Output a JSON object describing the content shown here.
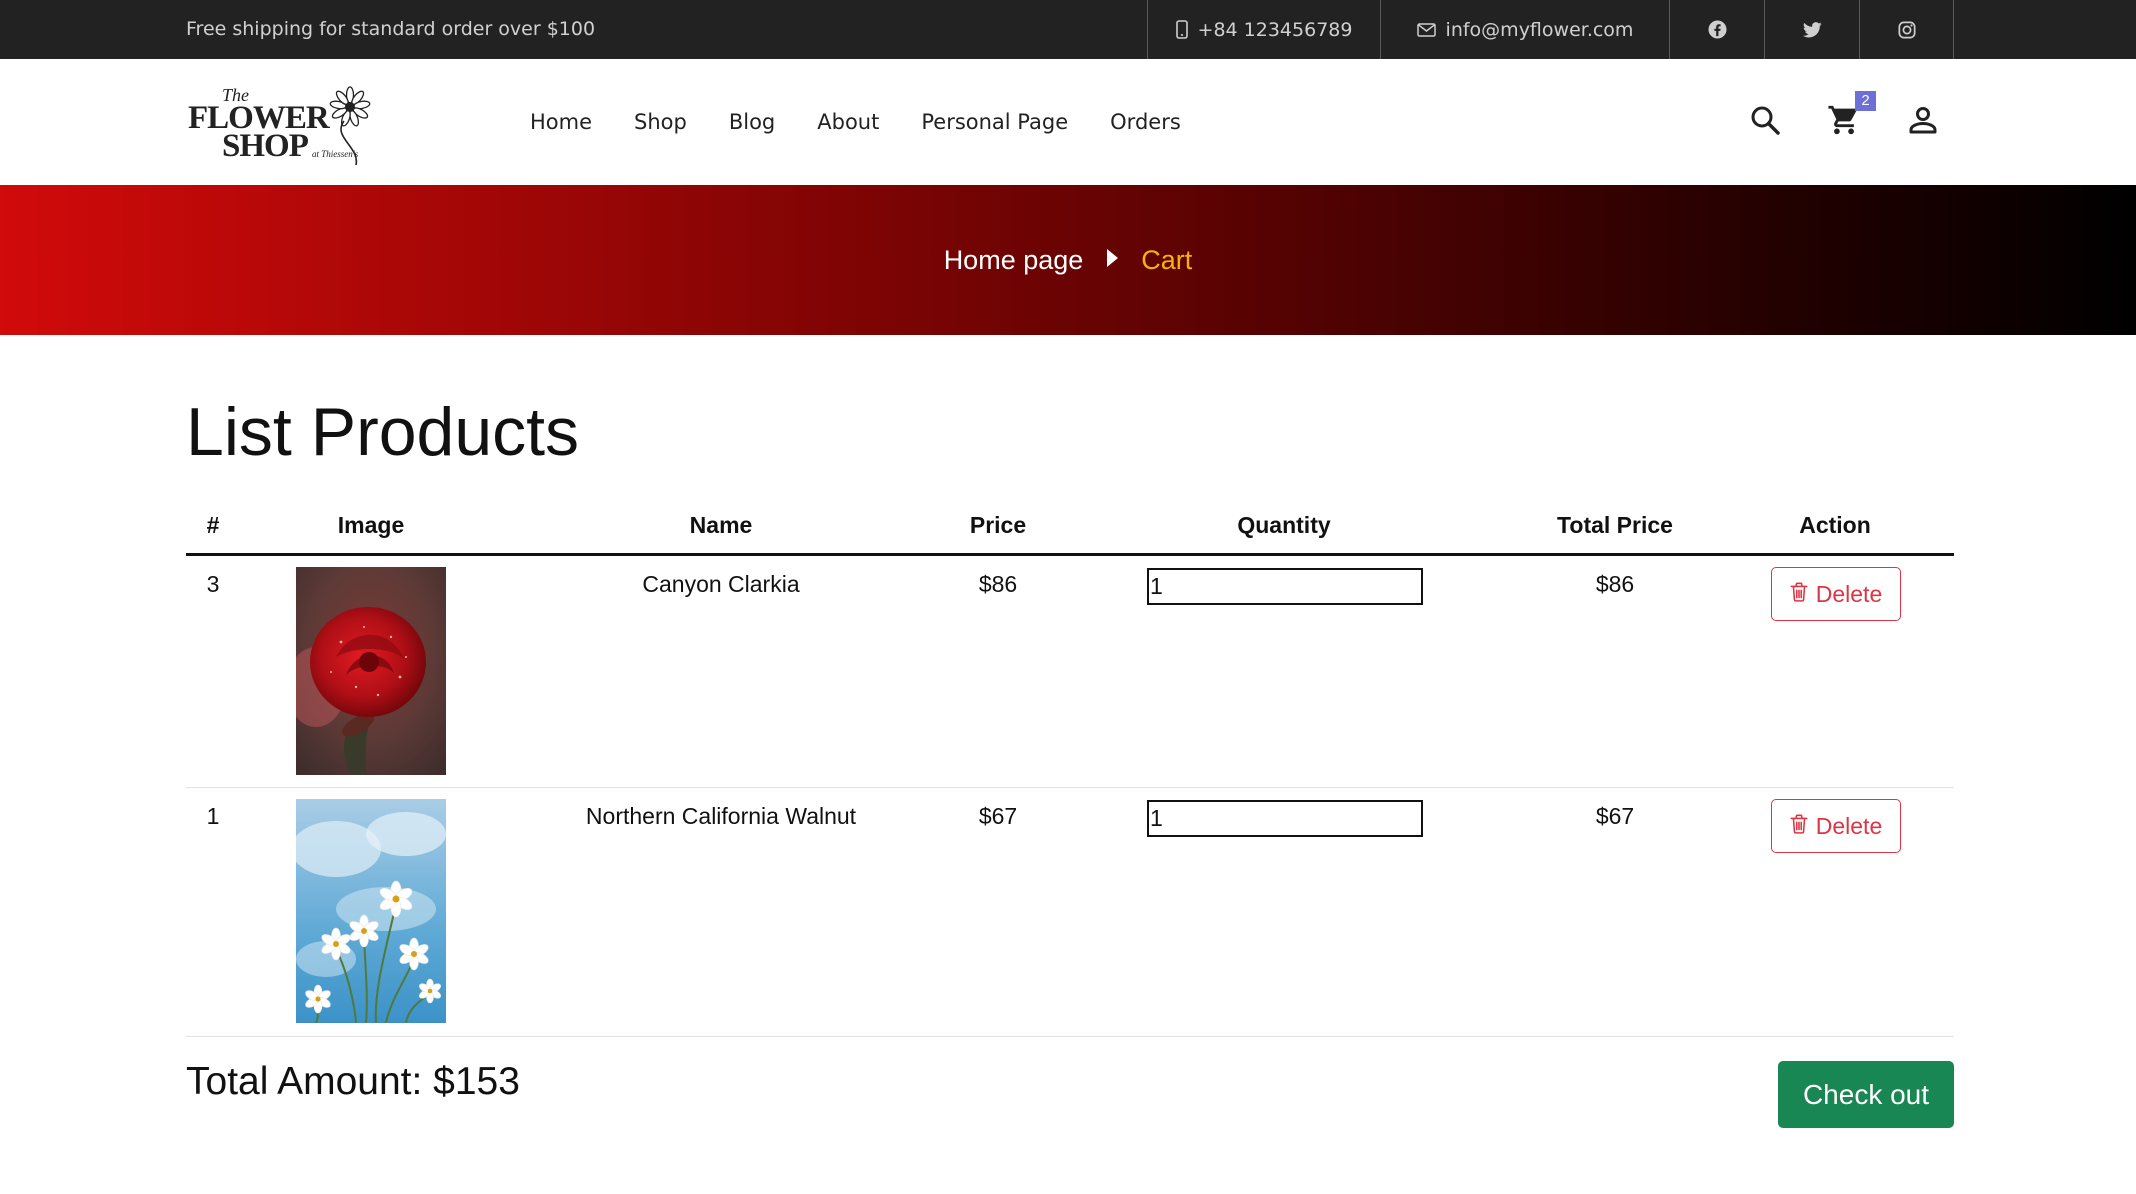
{
  "topbar": {
    "promo": "Free shipping for standard order over $100",
    "phone": "+84 123456789",
    "email": "info@myflower.com"
  },
  "logo": {
    "line1": "The",
    "line2": "FLOWER",
    "line3": "SHOP",
    "tagline": "at Thiessen's"
  },
  "nav": {
    "items": [
      {
        "label": "Home"
      },
      {
        "label": "Shop"
      },
      {
        "label": "Blog"
      },
      {
        "label": "About"
      },
      {
        "label": "Personal Page"
      },
      {
        "label": "Orders"
      }
    ]
  },
  "header": {
    "cart_count": "2"
  },
  "breadcrumb": {
    "home": "Home page",
    "current": "Cart"
  },
  "page": {
    "title": "List Products"
  },
  "table": {
    "headers": {
      "index": "#",
      "image": "Image",
      "name": "Name",
      "price": "Price",
      "quantity": "Quantity",
      "total": "Total Price",
      "action": "Action"
    },
    "rows": [
      {
        "index": "3",
        "image": "red-rose-photo",
        "name": "Canyon Clarkia",
        "price": "$86",
        "quantity": "1",
        "total": "$86",
        "action": "Delete"
      },
      {
        "index": "1",
        "image": "white-cosmos-photo",
        "name": "Northern California Walnut",
        "price": "$67",
        "quantity": "1",
        "total": "$67",
        "action": "Delete"
      }
    ]
  },
  "summary": {
    "total_label": "Total Amount: $153",
    "checkout_label": "Check out"
  },
  "colors": {
    "topbar_bg": "#222222",
    "banner_start": "#d10a0a",
    "banner_end": "#000000",
    "breadcrumb_active": "#f5b400",
    "delete": "#dc3545",
    "checkout_bg": "#198754",
    "badge_bg": "#6b6fd6"
  },
  "icons": {
    "phone": "phone-icon",
    "email": "mail-icon",
    "facebook": "facebook-icon",
    "twitter": "twitter-icon",
    "instagram": "instagram-icon",
    "search": "search-icon",
    "cart": "cart-icon",
    "user": "user-icon",
    "breadcrumb_sep": "caret-right-icon",
    "delete": "trash-icon"
  }
}
